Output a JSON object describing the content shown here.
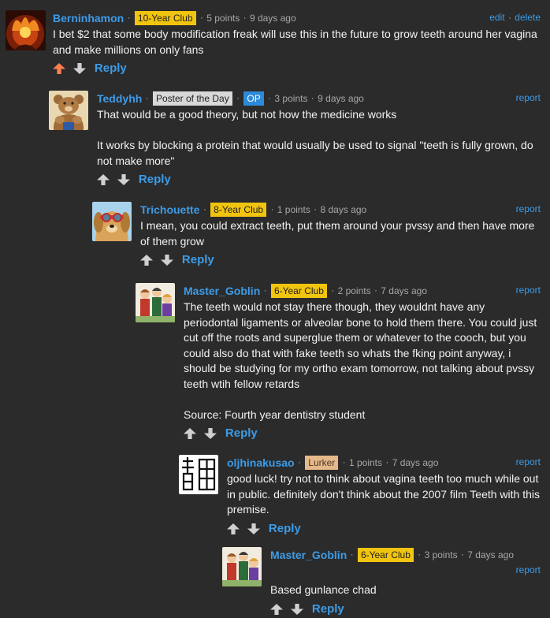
{
  "colors": {
    "background": "#2b2b2b",
    "username": "#3d9ce8",
    "upvoted": "#ff7f50"
  },
  "labels": {
    "reply": "Reply",
    "edit": "edit",
    "delete": "delete",
    "report": "report",
    "sep": "·"
  },
  "comments": [
    {
      "user": "Berninhamon",
      "badges": [
        "10-Year Club"
      ],
      "points": "5 points",
      "time": "9 days ago",
      "avatar_icon": "fiery-demon-avatar",
      "paragraphs": [
        "I bet $2 that some body modification freak will use this in the future to grow teeth around her vagina and make millions on only fans"
      ]
    },
    {
      "user": "Teddyhh",
      "badges": [
        "Poster of the Day",
        "OP"
      ],
      "points": "3 points",
      "time": "9 days ago",
      "avatar_icon": "muscular-teddy-bear-avatar",
      "paragraphs": [
        "That would be a good theory, but not how the medicine works",
        "It works by blocking a protein that would usually be used to signal \"teeth is fully grown, do not make more\""
      ]
    },
    {
      "user": "Trichouette",
      "badges": [
        "8-Year Club"
      ],
      "points": "1 points",
      "time": "8 days ago",
      "avatar_icon": "dog-with-goggles-avatar",
      "paragraphs": [
        "I mean, you could extract teeth, put them around your pvssy and then have more of them grow"
      ]
    },
    {
      "user": "Master_Goblin",
      "badges": [
        "6-Year Club"
      ],
      "points": "2 points",
      "time": "7 days ago",
      "avatar_icon": "anime-group-avatar",
      "paragraphs": [
        "The teeth would not stay there though, they wouldnt have any periodontal ligaments or alveolar bone to hold them there. You could just cut off the roots and superglue them or whatever to the cooch, but you could also do that with fake teeth so whats the fking point anyway, i should be studying for my ortho exam tomorrow, not talking about pvssy teeth wtih fellow retards",
        "Source: Fourth year dentistry student"
      ]
    },
    {
      "user": "oljhinakusao",
      "badges": [
        "Lurker"
      ],
      "points": "1 points",
      "time": "7 days ago",
      "avatar_icon": "kanji-glyph-avatar",
      "paragraphs": [
        "good luck! try not to think about vagina teeth too much while out in public. definitely don't think about the 2007 film Teeth with this premise."
      ]
    },
    {
      "user": "Master_Goblin",
      "badges": [
        "6-Year Club"
      ],
      "points": "3 points",
      "time": "7 days ago",
      "avatar_icon": "anime-group-avatar",
      "paragraphs": [
        "Based gunlance chad"
      ]
    }
  ]
}
